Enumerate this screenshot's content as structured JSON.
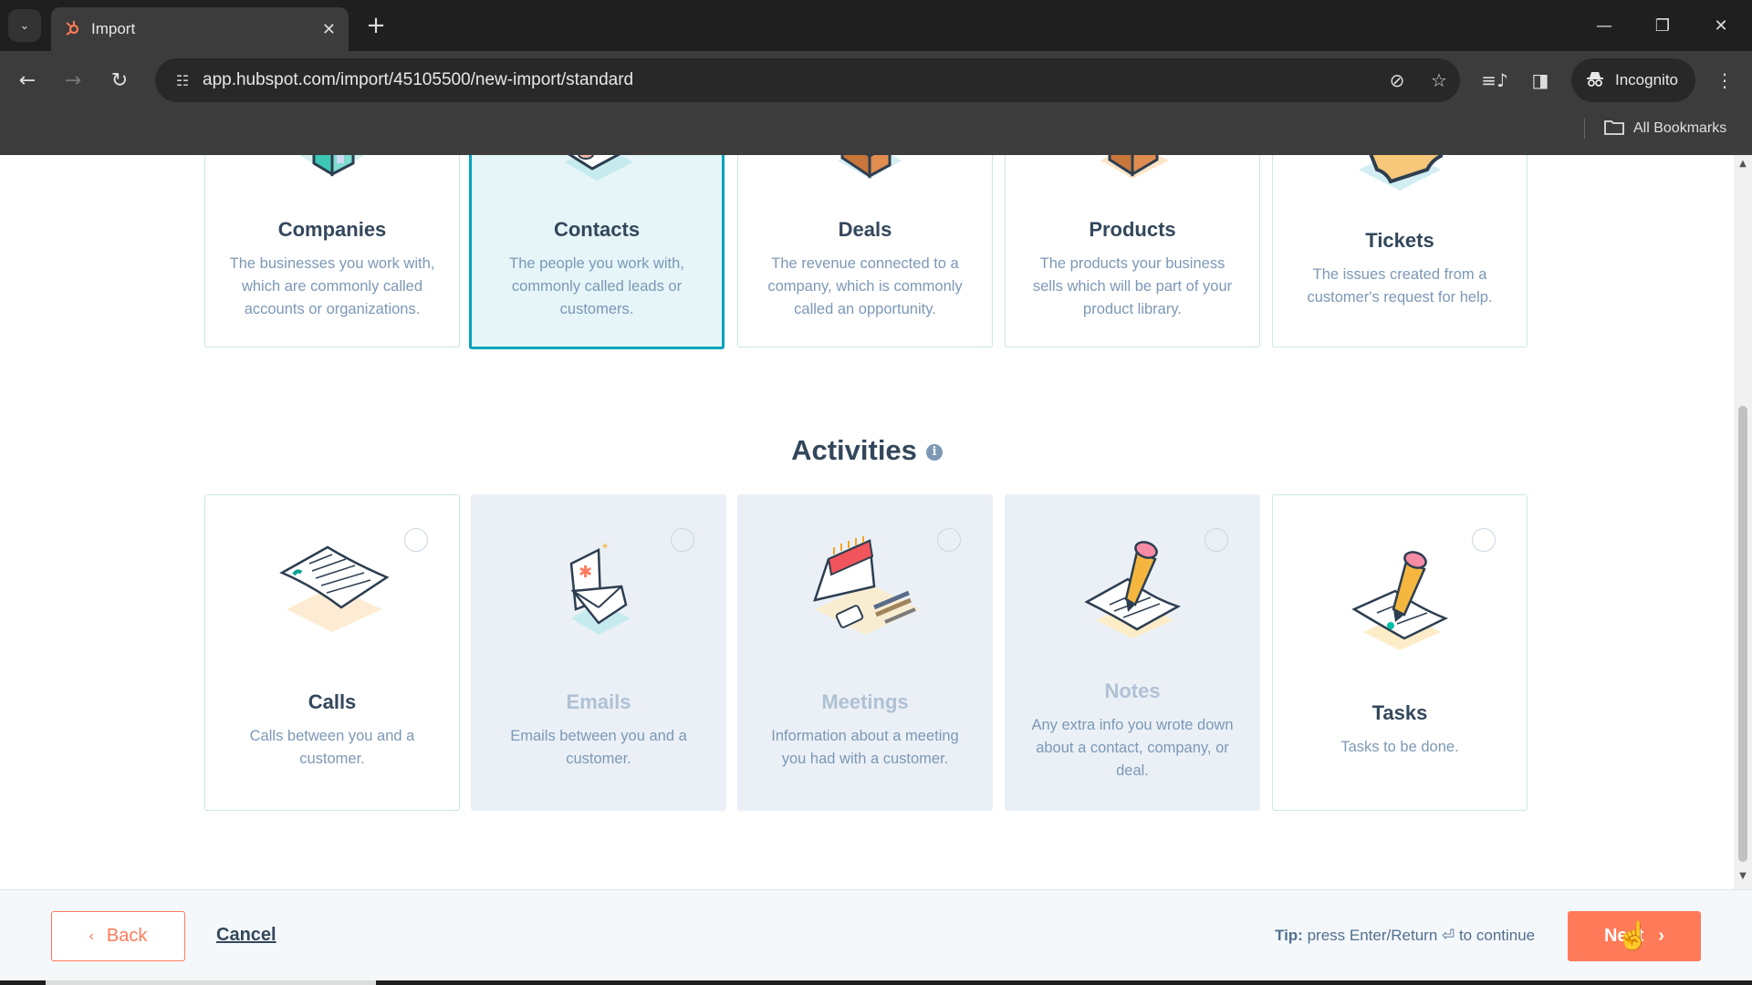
{
  "browser": {
    "tab_title": "Import",
    "url": "app.hubspot.com/import/45105500/new-import/standard",
    "incognito_label": "Incognito",
    "all_bookmarks_label": "All Bookmarks",
    "icons": {
      "tab_list": "chevron-down-icon",
      "favicon": "hubspot-icon",
      "tab_close": "close-icon",
      "new_tab": "plus-icon",
      "back": "arrow-left-icon",
      "forward": "arrow-right-icon",
      "reload": "reload-icon",
      "site_info": "tune-icon",
      "eye_off": "eye-off-icon",
      "star": "star-icon",
      "media": "media-control-icon",
      "side_panel": "side-panel-icon",
      "incognito": "incognito-icon",
      "menu": "kebab-menu-icon",
      "folder": "folder-icon"
    },
    "glyphs": {
      "tab_list": "⌄",
      "favicon": "⚙",
      "tab_close": "✕",
      "new_tab": "+",
      "back": "←",
      "forward": "→",
      "reload": "↻",
      "site_info": "☷",
      "eye_off": "⊘",
      "star": "☆",
      "media": "≡♪",
      "side_panel": "◨",
      "incognito": "🕶",
      "menu": "⋮",
      "folder": "🗀",
      "minimize": "—",
      "restore": "❐",
      "close": "✕"
    }
  },
  "objects": [
    {
      "title": "Companies",
      "description": "The businesses you work with, which are commonly called accounts or organizations.",
      "state": "default"
    },
    {
      "title": "Contacts",
      "description": "The people you work with, commonly called leads or customers.",
      "state": "selected"
    },
    {
      "title": "Deals",
      "description": "The revenue connected to a company, which is commonly called an opportunity.",
      "state": "default"
    },
    {
      "title": "Products",
      "description": "The products your business sells which will be part of your product library.",
      "state": "default"
    },
    {
      "title": "Tickets",
      "description": "The issues created from a customer's request for help.",
      "state": "default"
    }
  ],
  "activities": {
    "title": "Activities",
    "info_glyph": "i",
    "items": [
      {
        "title": "Calls",
        "description": "Calls between you and a customer.",
        "state": "default",
        "checked": false
      },
      {
        "title": "Emails",
        "description": "Emails between you and a customer.",
        "state": "disabled",
        "checked": false
      },
      {
        "title": "Meetings",
        "description": "Information about a meeting you had with a customer.",
        "state": "disabled",
        "checked": false
      },
      {
        "title": "Notes",
        "description": "Any extra info you wrote down about a contact, company, or deal.",
        "state": "disabled",
        "checked": false
      },
      {
        "title": "Tasks",
        "description": "Tasks to be done.",
        "state": "default",
        "checked": false
      }
    ]
  },
  "footer": {
    "back_label": "Back",
    "back_chevron": "‹",
    "cancel_label": "Cancel",
    "tip_prefix": "Tip:",
    "tip_text": "press Enter/Return ⏎ to continue",
    "next_label": "Next",
    "next_chevron": "›",
    "cursor_glyph": "☝"
  },
  "colors": {
    "accent": "#ff7a59",
    "selected_border": "#00a4bd",
    "selected_bg": "#e5f5f8",
    "disabled_bg": "#eaf0f6",
    "heading": "#33475b",
    "body_text": "#7c98b6"
  }
}
